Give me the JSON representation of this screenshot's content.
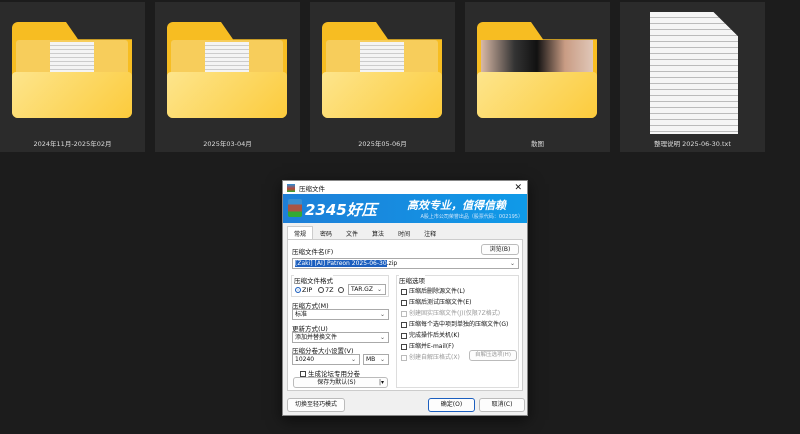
{
  "files": [
    {
      "name": "2024年11月-2025年02月",
      "type": "folder"
    },
    {
      "name": "2025年03-04月",
      "type": "folder"
    },
    {
      "name": "2025年05-06月",
      "type": "folder"
    },
    {
      "name": "散图",
      "type": "folder-image"
    },
    {
      "name": "整理说明 2025-06-30.txt",
      "type": "text-file"
    }
  ],
  "dialog": {
    "title": "压缩文件",
    "close": "✕",
    "banner": {
      "logo": "2345好压",
      "slogan": "高效专业，值得信赖",
      "sub": "A股上市公司荣誉出品（股票代码：002195）"
    },
    "tabs": [
      "常规",
      "密码",
      "文件",
      "算法",
      "时间",
      "注释"
    ],
    "filename_label": "压缩文件名(F)",
    "browse": "浏览(B)",
    "filename_selected": "[Zaki] [AI] Patreon 2025-06-30",
    "filename_ext": ".zip",
    "format_label": "压缩文件格式",
    "formats": [
      "ZIP",
      "7Z",
      ""
    ],
    "format_other": "TAR.GZ",
    "method_label": "压缩方式(M)",
    "method": "标准",
    "update_label": "更新方式(U)",
    "update": "添加并替换文件",
    "split_label": "压缩分卷大小设置(V)",
    "split_value": "10240",
    "split_unit": "MB",
    "forum_split": "生成论坛专用分卷",
    "save_default": "保存为默认(S)",
    "options_label": "压缩选项",
    "options": [
      {
        "label": "压缩后删除源文件(L)",
        "enabled": true
      },
      {
        "label": "压缩后测试压缩文件(E)",
        "enabled": true
      },
      {
        "label": "创建固实压缩文件(J)(仅限7Z格式)",
        "enabled": false
      },
      {
        "label": "压缩每个选中项到单独的压缩文件(G)",
        "enabled": true
      },
      {
        "label": "完成操作后关机(K)",
        "enabled": true
      },
      {
        "label": "压缩并E-mail(F)",
        "enabled": true
      },
      {
        "label": "创建自解压格式(X)",
        "enabled": false
      }
    ],
    "sfx_options": "自解压选项(H)",
    "switch_mode": "切换至轻巧模式",
    "ok": "确定(O)",
    "cancel": "取消(C)"
  }
}
